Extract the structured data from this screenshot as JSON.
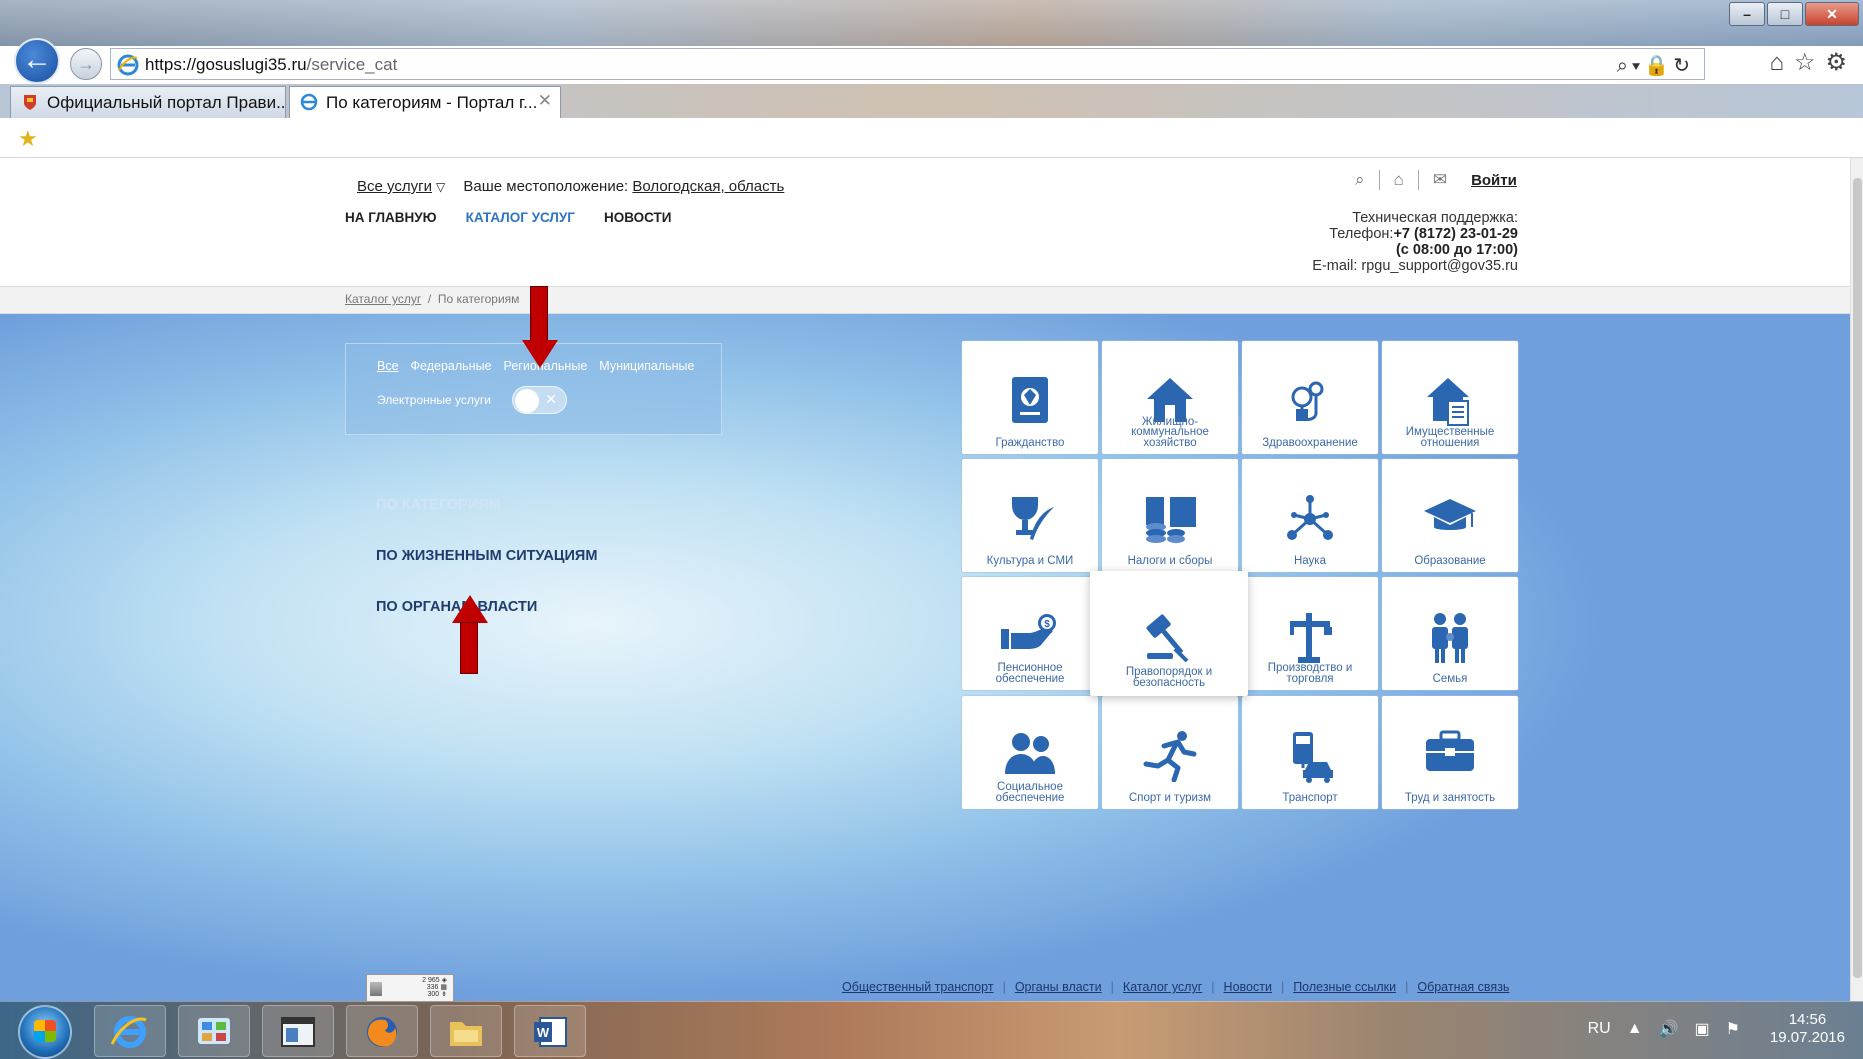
{
  "browser": {
    "url_host": "https://gosuslugi35.ru",
    "url_path": "/service_cat",
    "tabs": [
      {
        "label": "Официальный портал Прави..."
      },
      {
        "label": "По категориям - Портал г...",
        "close": "✕"
      }
    ]
  },
  "header": {
    "all_services": "Все услуги",
    "location_label": "Ваше местоположение:",
    "location_value": "Вологодская, область",
    "login": "Войти",
    "nav": [
      {
        "label": "НА ГЛАВНУЮ"
      },
      {
        "label": "КАТАЛОГ УСЛУГ"
      },
      {
        "label": "НОВОСТИ"
      }
    ],
    "support": {
      "title": "Техническая поддержка:",
      "phone_label": "Телефон:",
      "phone": "+7 (8172) 23-01-29",
      "hours": "(с 08:00 до 17:00)",
      "email": "E-mail: rpgu_support@gov35.ru"
    }
  },
  "breadcrumb": {
    "root": "Каталог услуг",
    "sep": "/",
    "current": "По категориям"
  },
  "filter": {
    "tabs": [
      {
        "label": "Все"
      },
      {
        "label": "Федеральные"
      },
      {
        "label": "Региональные"
      },
      {
        "label": "Муниципальные"
      }
    ],
    "electronic_label": "Электронные услуги",
    "toggle_off_mark": "✕"
  },
  "side_links": [
    {
      "label": "ПО КАТЕГОРИЯМ"
    },
    {
      "label": "ПО ЖИЗНЕННЫМ СИТУАЦИЯМ"
    },
    {
      "label": "ПО ОРГАНАМ ВЛАСТИ"
    }
  ],
  "categories": [
    {
      "label": "Гражданство",
      "icon": "passport-icon"
    },
    {
      "label": "Жилищно-коммунальное хозяйство",
      "icon": "house-icon"
    },
    {
      "label": "Здравоохранение",
      "icon": "stethoscope-icon"
    },
    {
      "label": "Имущественные отношения",
      "icon": "property-doc-icon"
    },
    {
      "label": "Культура и СМИ",
      "icon": "trophy-feather-icon"
    },
    {
      "label": "Налоги и сборы",
      "icon": "coins-icon"
    },
    {
      "label": "Наука",
      "icon": "molecule-icon"
    },
    {
      "label": "Образование",
      "icon": "graduation-cap-icon"
    },
    {
      "label": "Пенсионное обеспечение",
      "icon": "hand-coin-icon"
    },
    {
      "label": "Правопорядок и безопасность",
      "icon": "gavel-icon"
    },
    {
      "label": "Производство и торговля",
      "icon": "crane-icon"
    },
    {
      "label": "Семья",
      "icon": "family-icon"
    },
    {
      "label": "Социальное обеспечение",
      "icon": "people-icon"
    },
    {
      "label": "Спорт и туризм",
      "icon": "runner-icon"
    },
    {
      "label": "Транспорт",
      "icon": "transport-icon"
    },
    {
      "label": "Труд и занятость",
      "icon": "briefcase-icon"
    }
  ],
  "counter": {
    "line1": "2 965 ◈",
    "line2": "336 ▦",
    "line3": "300 ⇟"
  },
  "footer_links": [
    {
      "label": "Общественный транспорт"
    },
    {
      "label": "Органы власти"
    },
    {
      "label": "Каталог услуг"
    },
    {
      "label": "Новости"
    },
    {
      "label": "Полезные ссылки"
    },
    {
      "label": "Обратная связь"
    }
  ],
  "footer_sep": "|",
  "taskbar": {
    "lang": "RU",
    "time": "14:56",
    "date": "19.07.2016"
  },
  "colors": {
    "accent": "#2f74c0",
    "tile_label": "#3c6aa6",
    "icon_blue": "#2b66b0",
    "annotation_arrow": "#c00000"
  }
}
